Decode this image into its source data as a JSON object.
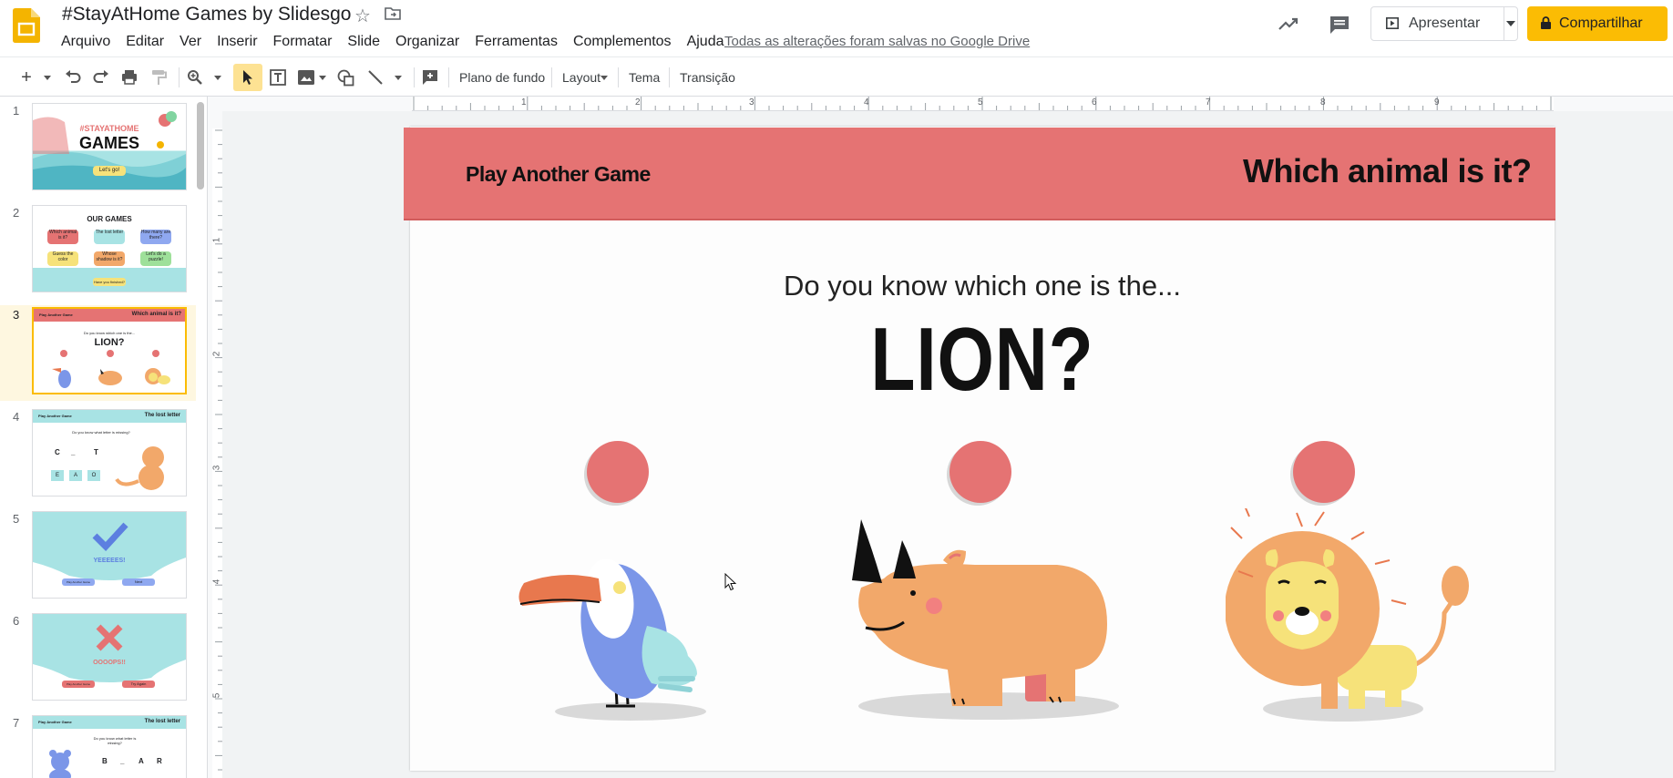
{
  "app": {
    "doc_title": "#StayAtHome Games by Slidesgo",
    "saved_status": "Todas as alterações foram salvas no Google Drive",
    "menu": [
      "Arquivo",
      "Editar",
      "Ver",
      "Inserir",
      "Formatar",
      "Slide",
      "Organizar",
      "Ferramentas",
      "Complementos",
      "Ajuda"
    ],
    "present_label": "Apresentar",
    "share_label": "Compartilhar",
    "accent_color": "#fbbc04"
  },
  "toolbar": {
    "background_label": "Plano de fundo",
    "layout_label": "Layout",
    "theme_label": "Tema",
    "transition_label": "Transição"
  },
  "rulers": {
    "horizontal": [
      "1",
      "2",
      "3",
      "4",
      "5",
      "6",
      "7",
      "8",
      "9"
    ],
    "vertical": [
      "1",
      "2",
      "3",
      "4",
      "5"
    ]
  },
  "filmstrip": {
    "selected_slide": 3,
    "slides": [
      {
        "num": "1",
        "title_line1": "#STAYATHOME",
        "title_line2": "GAMES",
        "button": "Let's go!"
      },
      {
        "num": "2",
        "title": "OUR GAMES",
        "tiles": [
          "Which animal is it?",
          "The lost letter",
          "How many are there?",
          "Guess the color",
          "Whose shadow is it?",
          "Let's do a puzzle!"
        ],
        "footer": "Have you finished?"
      },
      {
        "num": "3",
        "left": "Play Another Game",
        "right": "Which animal is it?",
        "question": "Do you know which one is the...",
        "answer": "LION?"
      },
      {
        "num": "4",
        "left": "Play Another Game",
        "right": "The lost letter",
        "question": "Do you know what letter is missing?",
        "letters": [
          "C",
          "_",
          "T"
        ],
        "options": [
          "E",
          "A",
          "O"
        ]
      },
      {
        "num": "5",
        "text": "YEEEEES!",
        "buttons": [
          "Play Another Game",
          "Next"
        ]
      },
      {
        "num": "6",
        "text": "OOOOPS!!",
        "buttons": [
          "Play Another Game",
          "Try Again"
        ]
      },
      {
        "num": "7",
        "left": "Play Another Game",
        "right": "The lost letter",
        "question": "Do you know what letter is missing?",
        "letters": [
          "B",
          "_",
          "A",
          "R"
        ]
      }
    ]
  },
  "slide": {
    "banner_left": "Play Another Game",
    "banner_right": "Which animal is it?",
    "banner_color": "#e57373",
    "question": "Do you know which one is the...",
    "answer": "LION?",
    "animals": [
      "toucan",
      "rhino",
      "lion"
    ]
  }
}
